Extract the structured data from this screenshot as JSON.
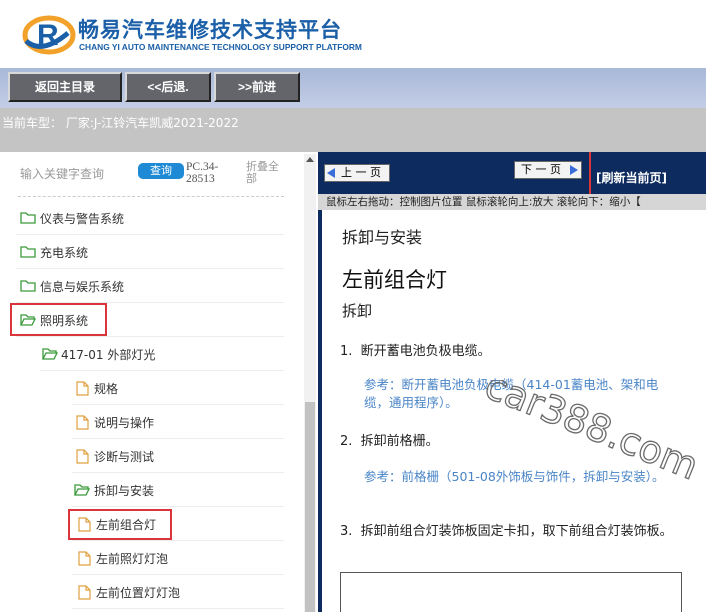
{
  "header": {
    "brand_cn": "畅易汽车维修技术支持平台",
    "brand_en": "CHANG YI AUTO MAINTENANCE TECHNOLOGY SUPPORT PLATFORM",
    "logo_letter": "R"
  },
  "nav": {
    "home": "返回主目录",
    "back": "<<后退.",
    "forward": ">>前进"
  },
  "current_model": "当前车型：  厂家:J-江铃汽车凯威2021-2022",
  "search": {
    "placeholder": "输入关键字查询",
    "button": "查询",
    "code": "PC.34-28513",
    "collapse": "折叠全部"
  },
  "tree": [
    {
      "label": "仪表与警告系统",
      "type": "folder"
    },
    {
      "label": "充电系统",
      "type": "folder"
    },
    {
      "label": "信息与娱乐系统",
      "type": "folder"
    },
    {
      "label": "照明系统",
      "type": "folder-open"
    },
    {
      "label": "417-01 外部灯光",
      "type": "folder-open"
    },
    {
      "label": "规格",
      "type": "page"
    },
    {
      "label": "说明与操作",
      "type": "page"
    },
    {
      "label": "诊断与测试",
      "type": "page"
    },
    {
      "label": "拆卸与安装",
      "type": "folder-open"
    },
    {
      "label": "左前组合灯",
      "type": "page"
    },
    {
      "label": "左前照灯灯泡",
      "type": "page"
    },
    {
      "label": "左前位置灯灯泡",
      "type": "page"
    }
  ],
  "pager": {
    "prev": "上 一 页",
    "next": "下 一 页",
    "refresh": "[刷新当前页]",
    "tip": "鼠标左右拖动：控制图片位置  鼠标滚轮向上:放大  滚轮向下：缩小【"
  },
  "doc": {
    "section": "拆卸与安装",
    "title": "左前组合灯",
    "subtitle": "拆卸",
    "steps": [
      {
        "num": "1.",
        "text": "断开蓄电池负极电缆。",
        "ref": "参考：断开蓄电池负极电缆（414-01蓄电池、架和电缆，通用程序）。"
      },
      {
        "num": "2.",
        "text": "拆卸前格栅。",
        "ref": "参考：前格栅（501-08外饰板与饰件，拆卸与安装）。"
      },
      {
        "num": "3.",
        "text": "拆卸前组合灯装饰板固定卡扣，取下前组合灯装饰板。",
        "ref": ""
      }
    ]
  },
  "watermark": "car388.com",
  "colors": {
    "brand": "#1a5fa8",
    "highlight": "#d9353a",
    "doc_bg": "#0d2b5e",
    "link": "#4a85c7"
  }
}
